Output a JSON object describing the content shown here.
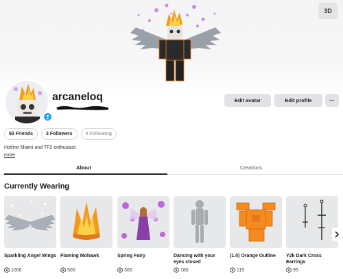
{
  "hero": {
    "btn_3d": "3D"
  },
  "profile": {
    "username": "arcaneloq",
    "actions": {
      "edit_avatar": "Edit avatar",
      "edit_profile": "Edit profile",
      "more": "···"
    },
    "stats": [
      {
        "count": "93",
        "label": "Friends"
      },
      {
        "count": "3",
        "label": "Followers"
      },
      {
        "count": "0",
        "label": "Following"
      }
    ],
    "stats_text": [
      "93 Friends",
      "3 Followers",
      "0 Following"
    ],
    "bio": "Hotline Miami and TF2 enthusiast.",
    "more_link": "more"
  },
  "tabs": {
    "about": "About",
    "creations": "Creations"
  },
  "section": {
    "currently_wearing": "Currently Wearing"
  },
  "items": [
    {
      "name": "Sparkling Angel Wings",
      "price": "1000",
      "icon": "angel-wings-icon"
    },
    {
      "name": "Flaming Mohawk",
      "price": "500",
      "icon": "flaming-mohawk-icon"
    },
    {
      "name": "Spring Fairy",
      "price": "300",
      "icon": "spring-fairy-icon"
    },
    {
      "name": "Dancing with your eyes closed",
      "price": "180",
      "icon": "mannequin-icon"
    },
    {
      "name": "(1.0) Orange Outline",
      "price": "115",
      "icon": "orange-shirt-icon"
    },
    {
      "name": "Y2k Dark Cross Earrings",
      "price": "95",
      "icon": "cross-earrings-icon"
    }
  ],
  "colors": {
    "accent_blue": "#1ea4f0",
    "button_gray": "#e1e2e5",
    "item_bg": "#e7e8ea",
    "flame_orange": "#f29a1e"
  }
}
